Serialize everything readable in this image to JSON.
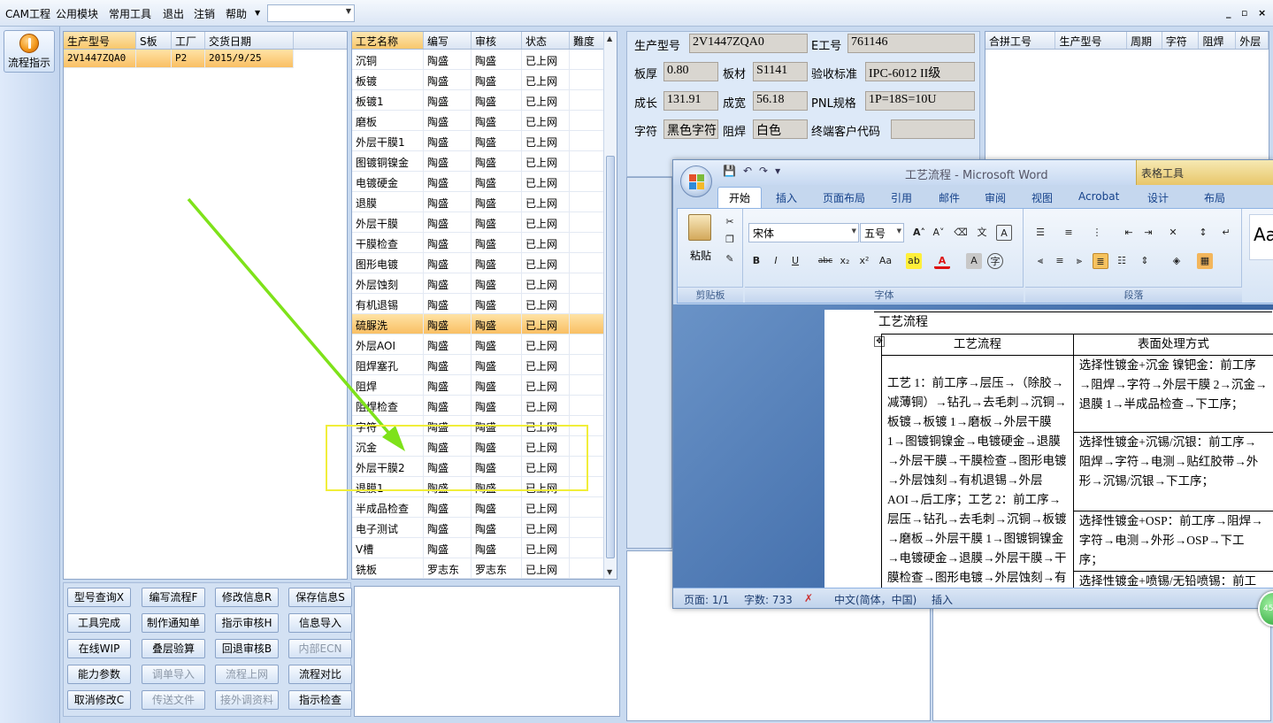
{
  "menu": {
    "items": [
      "CAM工程",
      "公用模块",
      "常用工具",
      "退出",
      "注销",
      "帮助"
    ],
    "combo_value": "",
    "window_controls": [
      "_",
      "▫",
      "×"
    ]
  },
  "left_strip": {
    "flow_button_label": "流程指示"
  },
  "order_grid": {
    "columns": [
      "生产型号",
      "S板",
      "工厂",
      "交货日期"
    ],
    "rows": [
      [
        "2V1447ZQA0",
        "",
        "P2",
        "2015/9/25"
      ]
    ]
  },
  "process_grid": {
    "columns": [
      "工艺名称",
      "编写",
      "审核",
      "状态",
      "難度"
    ],
    "rows": [
      [
        "沉铜",
        "陶盛",
        "陶盛",
        "已上网",
        ""
      ],
      [
        "板镀",
        "陶盛",
        "陶盛",
        "已上网",
        ""
      ],
      [
        "板镀1",
        "陶盛",
        "陶盛",
        "已上网",
        ""
      ],
      [
        "磨板",
        "陶盛",
        "陶盛",
        "已上网",
        ""
      ],
      [
        "外层干膜1",
        "陶盛",
        "陶盛",
        "已上网",
        ""
      ],
      [
        "图镀铜镍金",
        "陶盛",
        "陶盛",
        "已上网",
        ""
      ],
      [
        "电镀硬金",
        "陶盛",
        "陶盛",
        "已上网",
        ""
      ],
      [
        "退膜",
        "陶盛",
        "陶盛",
        "已上网",
        ""
      ],
      [
        "外层干膜",
        "陶盛",
        "陶盛",
        "已上网",
        ""
      ],
      [
        "干膜检查",
        "陶盛",
        "陶盛",
        "已上网",
        ""
      ],
      [
        "图形电镀",
        "陶盛",
        "陶盛",
        "已上网",
        ""
      ],
      [
        "外层蚀刻",
        "陶盛",
        "陶盛",
        "已上网",
        ""
      ],
      [
        "有机退锡",
        "陶盛",
        "陶盛",
        "已上网",
        ""
      ],
      [
        "硫脲洗",
        "陶盛",
        "陶盛",
        "已上网",
        ""
      ],
      [
        "外层AOI",
        "陶盛",
        "陶盛",
        "已上网",
        ""
      ],
      [
        "阻焊塞孔",
        "陶盛",
        "陶盛",
        "已上网",
        ""
      ],
      [
        "阻焊",
        "陶盛",
        "陶盛",
        "已上网",
        ""
      ],
      [
        "阻焊检查",
        "陶盛",
        "陶盛",
        "已上网",
        ""
      ],
      [
        "字符",
        "陶盛",
        "陶盛",
        "已上网",
        ""
      ],
      [
        "沉金",
        "陶盛",
        "陶盛",
        "已上网",
        ""
      ],
      [
        "外层干膜2",
        "陶盛",
        "陶盛",
        "已上网",
        ""
      ],
      [
        "退膜1",
        "陶盛",
        "陶盛",
        "已上网",
        ""
      ],
      [
        "半成品检查",
        "陶盛",
        "陶盛",
        "已上网",
        ""
      ],
      [
        "电子测试",
        "陶盛",
        "陶盛",
        "已上网",
        ""
      ],
      [
        "V槽",
        "陶盛",
        "陶盛",
        "已上网",
        ""
      ],
      [
        "铣板",
        "罗志东",
        "罗志东",
        "已上网",
        ""
      ]
    ],
    "selected_row": "硫脲洗"
  },
  "buttons": [
    {
      "label": "型号查询X",
      "enabled": true
    },
    {
      "label": "编写流程F",
      "enabled": true
    },
    {
      "label": "修改信息R",
      "enabled": true
    },
    {
      "label": "保存信息S",
      "enabled": true
    },
    {
      "label": "工具完成",
      "enabled": true
    },
    {
      "label": "制作通知单",
      "enabled": true
    },
    {
      "label": "指示审核H",
      "enabled": true
    },
    {
      "label": "信息导入",
      "enabled": true
    },
    {
      "label": "在线WIP",
      "enabled": true
    },
    {
      "label": "叠层验算",
      "enabled": true
    },
    {
      "label": "回退审核B",
      "enabled": true
    },
    {
      "label": "内部ECN",
      "enabled": false
    },
    {
      "label": "能力参数",
      "enabled": true
    },
    {
      "label": "调单导入",
      "enabled": false
    },
    {
      "label": "流程上网",
      "enabled": false
    },
    {
      "label": "流程对比",
      "enabled": true
    },
    {
      "label": "取消修改C",
      "enabled": true
    },
    {
      "label": "传送文件",
      "enabled": false
    },
    {
      "label": "接外调资料",
      "enabled": false
    },
    {
      "label": "指示检查",
      "enabled": true
    }
  ],
  "info": {
    "model_label": "生产型号",
    "model_value": "2V1447ZQA0",
    "e_label": "E工号",
    "e_value": "761146",
    "thick_label": "板厚",
    "thick_value": "0.80",
    "material_label": "板材",
    "material_value": "S1141",
    "std_label": "验收标准",
    "std_value": "IPC-6012 II级",
    "len_label": "成长",
    "len_value": "131.91",
    "width_label": "成宽",
    "width_value": "56.18",
    "pnl_label": "PNL规格",
    "pnl_value": "1P=18S=10U",
    "char_label": "字符",
    "char_value": "黑色字符",
    "mask_label": "阻焊",
    "mask_value": "白色",
    "cust_label": "终端客户代码",
    "cust_value": ""
  },
  "combine_grid": {
    "columns": [
      "合拼工号",
      "生产型号",
      "周期",
      "字符",
      "阻焊",
      "外层"
    ]
  },
  "word": {
    "caption": "工艺流程 - Microsoft Word",
    "table_tools": "表格工具",
    "tabs": [
      "开始",
      "插入",
      "页面布局",
      "引用",
      "邮件",
      "审阅",
      "视图",
      "Acrobat",
      "设计",
      "布局"
    ],
    "paste_label": "粘贴",
    "clipboard_label": "剪贴板",
    "font_group_label": "字体",
    "para_group_label": "段落",
    "font_name": "宋体",
    "font_size": "五号",
    "style_preview": "Aa",
    "doc_title": "工艺流程",
    "col_headers": [
      "工艺流程",
      "表面处理方式"
    ],
    "flow_text": "工艺 1：前工序→层压→（除胶→减薄铜）→钻孔→去毛刺→沉铜→板镀→板镀 1→磨板→外层干膜 1→图镀铜镍金→电镀硬金→退膜→外层干膜→干膜检查→图形电镀→外层蚀刻→有机退锡→外层 AOI→后工序；工艺 2：前工序→层压→钻孔→去毛刺→沉铜→板镀→磨板→外层干膜 1→图镀铜镍金→电镀硬金→退膜→外层干膜→干膜检查→图形电镀→外层蚀刻→有机退锡→外层 AOI→",
    "surface_1": "选择性镀金+沉金 镍钯金：前工序→阻焊→字符→外层干膜 2→沉金→退膜 1→半成品检查→下工序；",
    "surface_2": "选择性镀金+沉锡/沉银：前工序→阻焊→字符→电测→贴红胶带→外形→沉锡/沉银→下工序；",
    "surface_3": "选择性镀金+OSP：前工序→阻焊→字符→电测→外形→OSP→下工序；",
    "surface_4": "选择性镀金+喷锡/无铅喷锡：前工",
    "status_page": "页面: 1/1",
    "status_words": "字数: 733",
    "status_lang": "中文(简体，中国)",
    "status_mode": "插入"
  },
  "badge_text": "45",
  "colors": {
    "selection": "#f9bf63",
    "annotation_arrow": "#7ee21a",
    "annotation_box": "#f1ee3a"
  }
}
